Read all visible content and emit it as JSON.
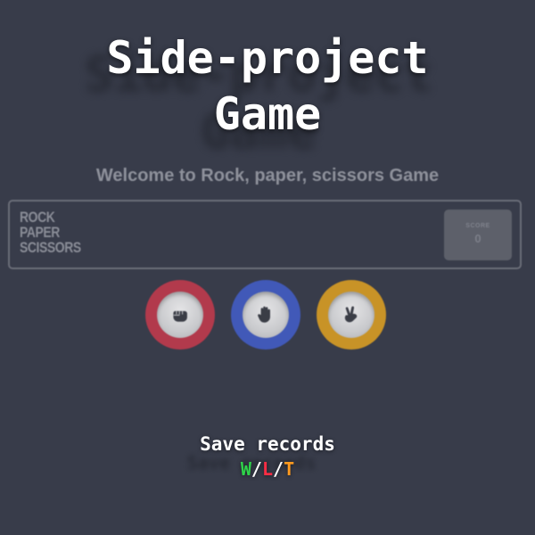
{
  "title": {
    "line1": "Side-project",
    "line2": "Game"
  },
  "welcome_text": "Welcome to Rock, paper, scissors Game",
  "header": {
    "logo_lines": [
      "ROCK",
      "PAPER",
      "SCISSORS"
    ],
    "score_label": "SCORE",
    "score_value": "0"
  },
  "choices": [
    {
      "name": "rock",
      "icon": "fist-icon",
      "ring_color": "#b23a4c"
    },
    {
      "name": "paper",
      "icon": "open-hand-icon",
      "ring_color": "#4159b8"
    },
    {
      "name": "scissors",
      "icon": "peace-hand-icon",
      "ring_color": "#c89327"
    }
  ],
  "records": {
    "label": "Save records",
    "win": "W",
    "loss": "L",
    "tie": "T",
    "separator": "/",
    "win_color": "#2fd44a",
    "loss_color": "#ff2d44",
    "tie_color": "#ff9a1f"
  }
}
